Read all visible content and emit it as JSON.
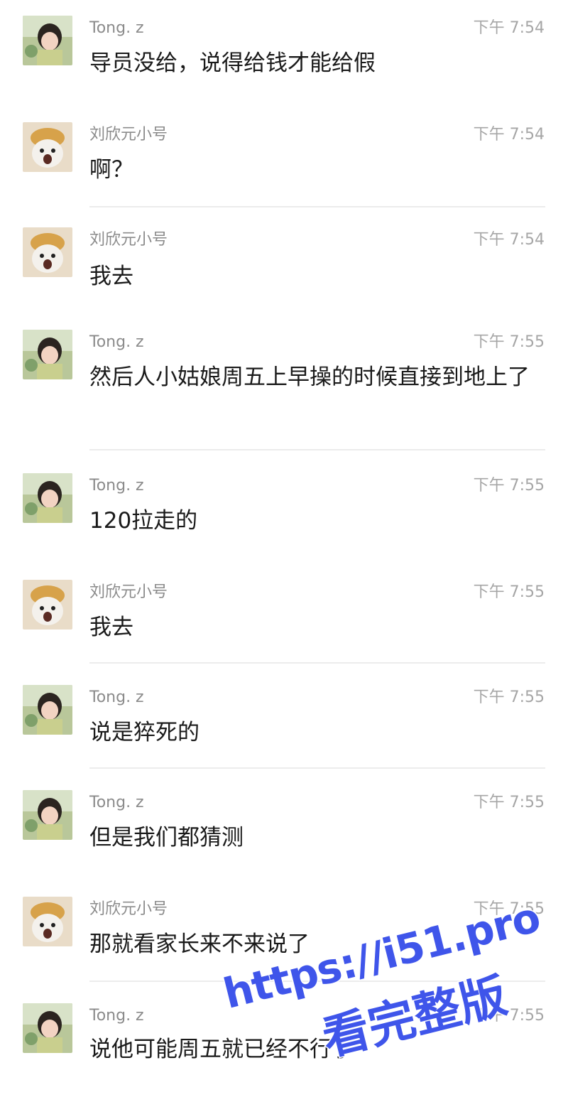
{
  "messages": [
    {
      "sender": "Tong. z",
      "avatar": "girl-avatar-icon",
      "time": "下午 7:54",
      "text": "导员没给，说得给钱才能给假"
    },
    {
      "sender": "刘欣元小号",
      "avatar": "dog-avatar-icon",
      "time": "下午 7:54",
      "text": "啊？"
    },
    {
      "sender": "刘欣元小号",
      "avatar": "dog-avatar-icon",
      "time": "下午 7:54",
      "text": "我去"
    },
    {
      "sender": "Tong. z",
      "avatar": "girl-avatar-icon",
      "time": "下午 7:55",
      "text": "然后人小姑娘周五上早操的时候直接到地上了"
    },
    {
      "sender": "Tong. z",
      "avatar": "girl-avatar-icon",
      "time": "下午 7:55",
      "text": "120拉走的"
    },
    {
      "sender": "刘欣元小号",
      "avatar": "dog-avatar-icon",
      "time": "下午 7:55",
      "text": "我去"
    },
    {
      "sender": "Tong. z",
      "avatar": "girl-avatar-icon",
      "time": "下午 7:55",
      "text": "说是猝死的"
    },
    {
      "sender": "Tong. z",
      "avatar": "girl-avatar-icon",
      "time": "下午 7:55",
      "text": "但是我们都猜测"
    },
    {
      "sender": "刘欣元小号",
      "avatar": "dog-avatar-icon",
      "time": "下午 7:55",
      "text": "那就看家长来不来说了"
    },
    {
      "sender": "Tong. z",
      "avatar": "girl-avatar-icon",
      "time": "下午 7:55",
      "text": "说他可能周五就已经不行了"
    }
  ],
  "watermark": {
    "line1": "https://i51.pro",
    "line2": "看完整版",
    "color": "#3f55ea"
  }
}
